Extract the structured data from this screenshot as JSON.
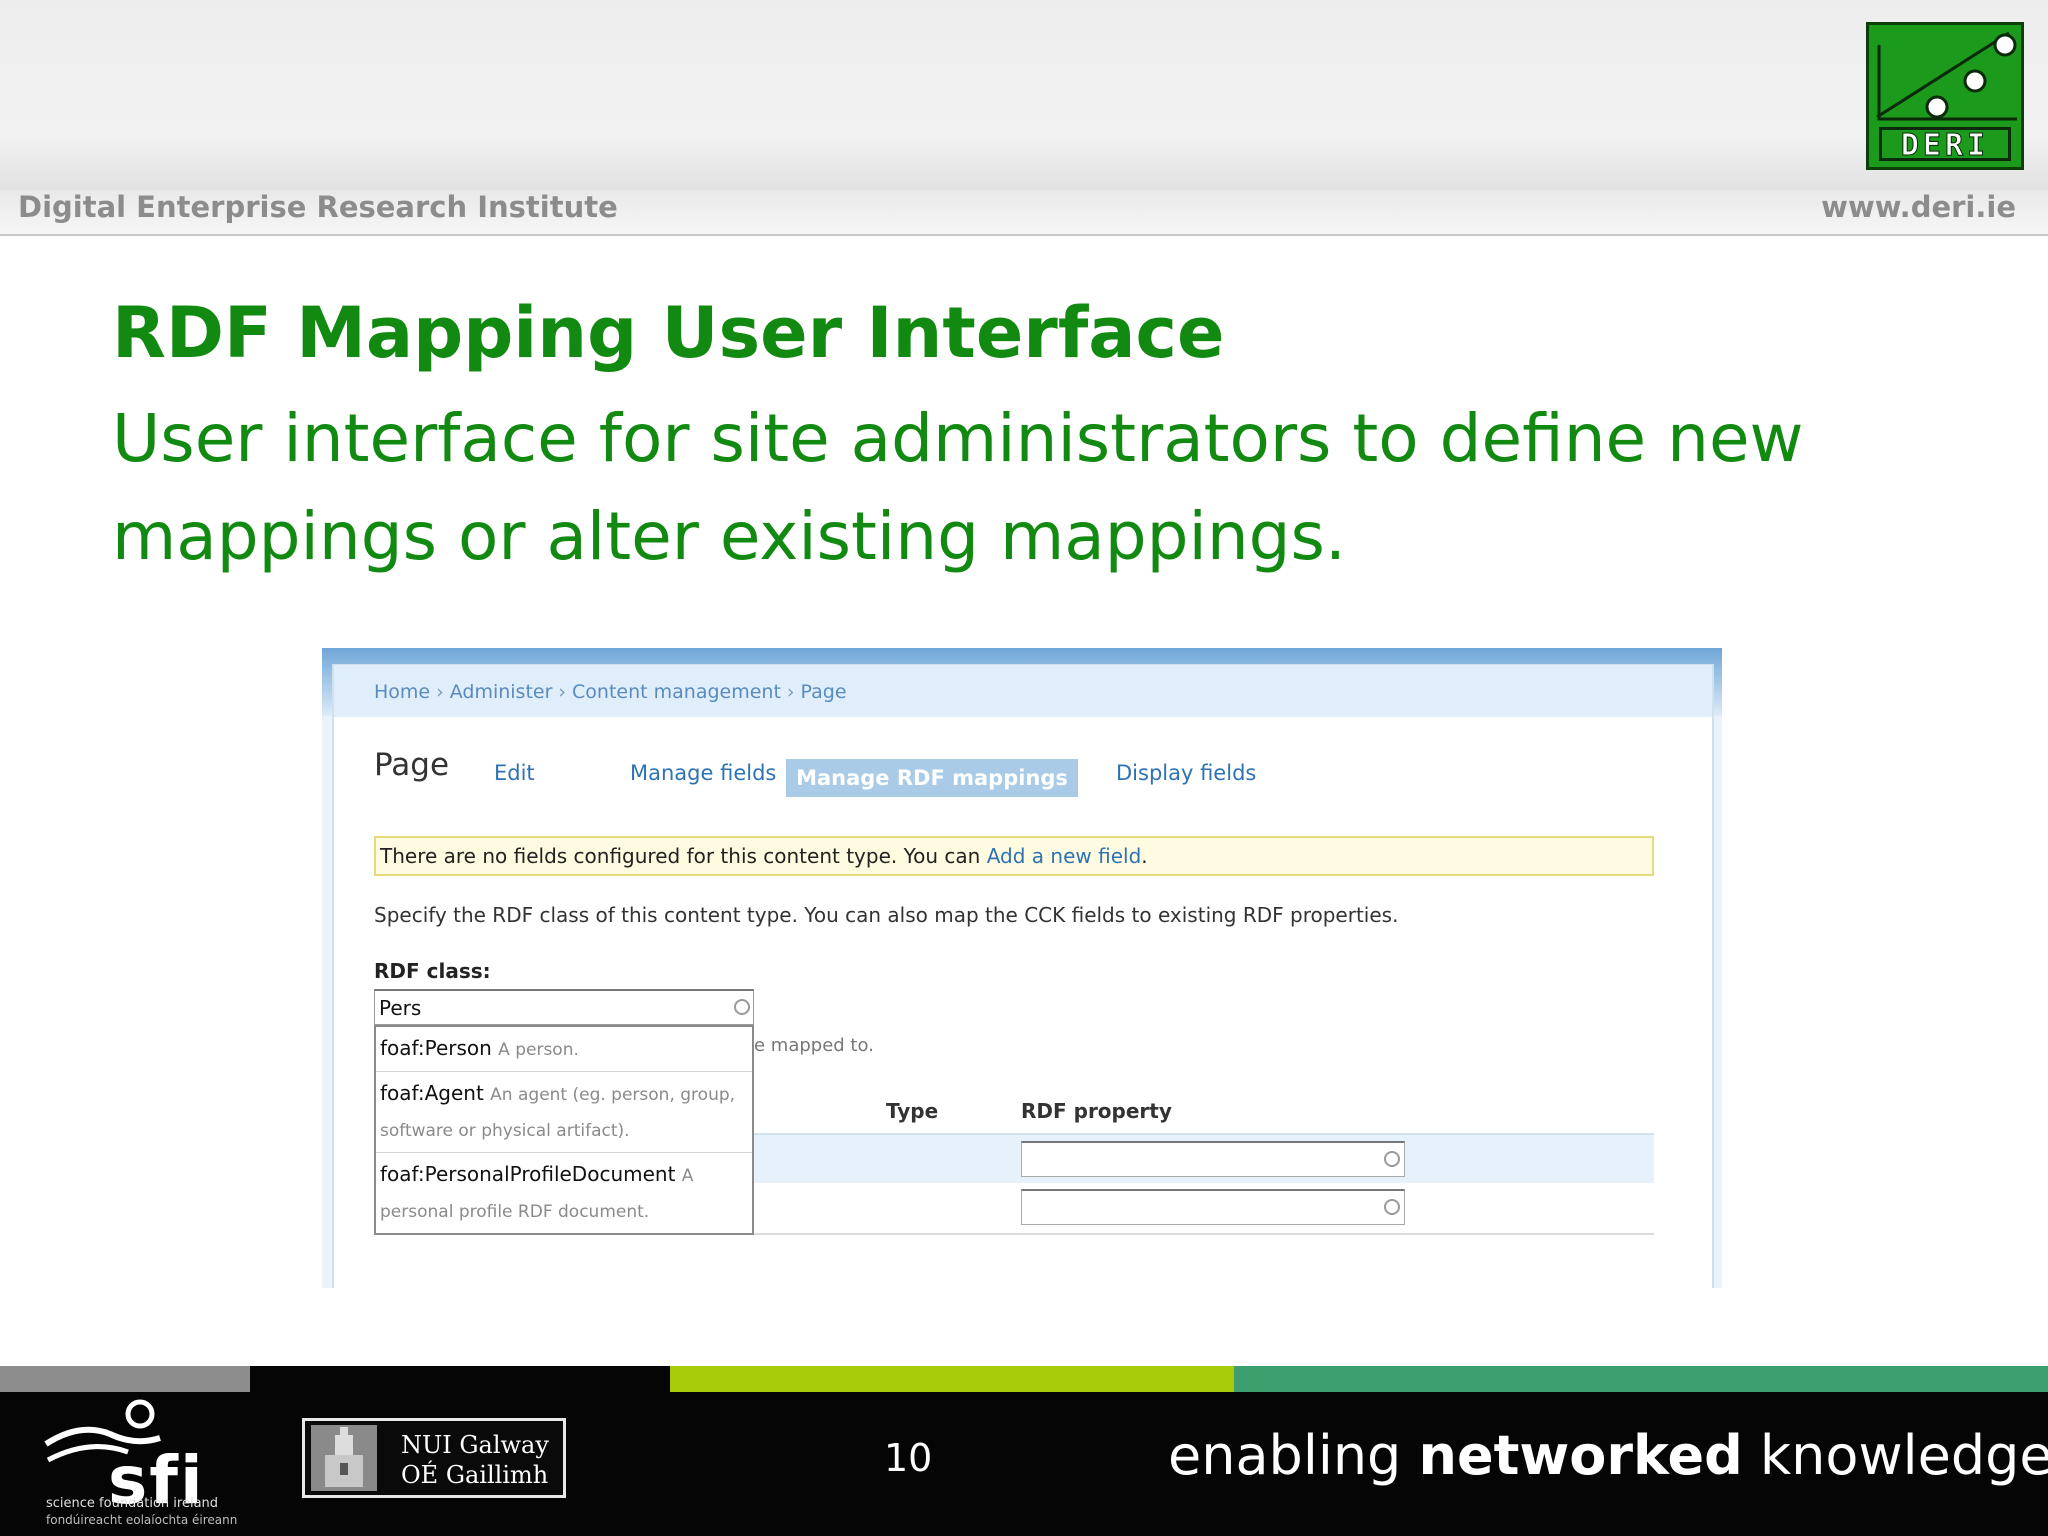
{
  "header": {
    "org": "Digital Enterprise Research Institute",
    "url": "www.deri.ie",
    "logo_text": "DERI"
  },
  "slide": {
    "title": "RDF Mapping User Interface",
    "subtitle": "User interface for site administrators to define new mappings or alter existing mappings."
  },
  "screenshot": {
    "breadcrumbs": [
      "Home",
      "Administer",
      "Content management",
      "Page"
    ],
    "breadcrumb_sep": "›",
    "page_title": "Page",
    "tabs": {
      "edit": "Edit",
      "manage_fields": "Manage fields",
      "manage_rdf": "Manage RDF mappings",
      "display_fields": "Display fields"
    },
    "notice": {
      "text": "There are no fields configured for this content type. You can ",
      "link": "Add a new field",
      "end": "."
    },
    "description": "Specify the RDF class of this content type. You can also map the CCK fields to existing RDF properties.",
    "rdf_class_label": "RDF class:",
    "rdf_class_value": "Pers",
    "help_partial": "e mapped to.",
    "columns": {
      "type": "Type",
      "rdf_property": "RDF property"
    },
    "autocomplete": [
      {
        "term": "foaf:Person",
        "desc": "A person."
      },
      {
        "term": "foaf:Agent",
        "desc": "An agent (eg. person, group, software or physical artifact)."
      },
      {
        "term": "foaf:PersonalProfileDocument",
        "desc": "A personal profile RDF document."
      }
    ]
  },
  "footer": {
    "sfi": "sfi",
    "sfi_line1": "science foundation ireland",
    "sfi_line2": "fondúireacht eolaíochta éireann",
    "nui_line1": "NUI Galway",
    "nui_line2": "OÉ Gaillimh",
    "slide_number": "10",
    "tagline_pre": "enabling ",
    "tagline_bold": "networked",
    "tagline_post": " knowledge.",
    "stripe_colors": [
      "#8d8d8d",
      "#050505",
      "#a8cc0a",
      "#3e9f6e"
    ]
  }
}
